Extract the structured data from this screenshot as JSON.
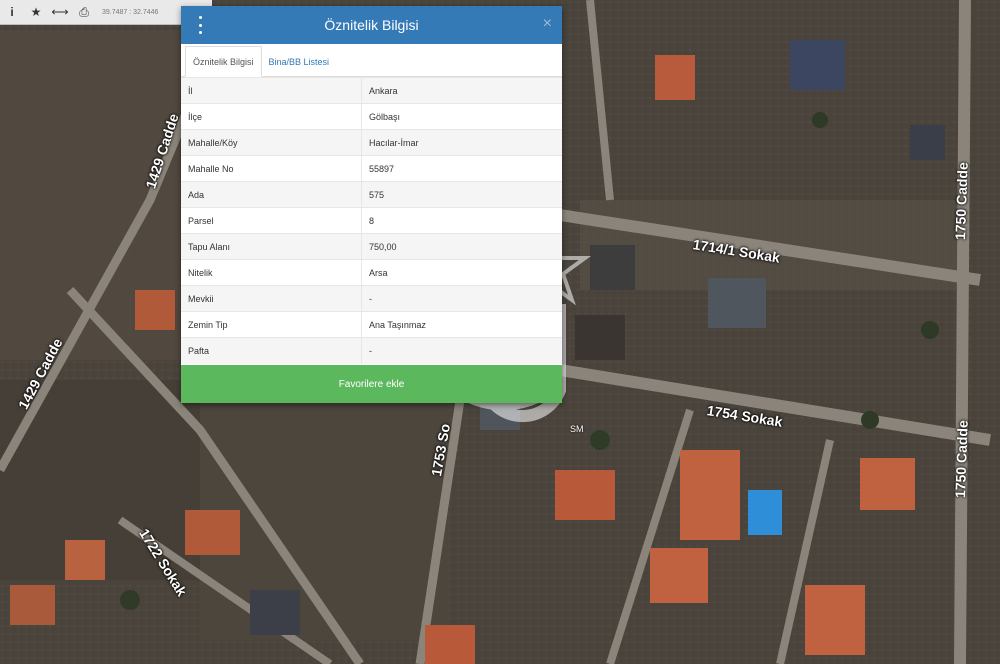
{
  "toolbar": {
    "icons": [
      "info-icon",
      "star-icon",
      "measure-icon",
      "print-icon"
    ],
    "info_glyph": "i",
    "star_glyph": "★",
    "measure_glyph": "⟷",
    "print_glyph": "⎙",
    "coords": "39.7487 : 32.7446"
  },
  "dialog": {
    "title": "Öznitelik Bilgisi",
    "close_glyph": "×",
    "tabs": [
      {
        "label": "Öznitelik Bilgisi",
        "active": true
      },
      {
        "label": "Bina/BB Listesi",
        "active": false
      }
    ],
    "rows": [
      {
        "key": "İl",
        "value": "Ankara"
      },
      {
        "key": "İlçe",
        "value": "Gölbaşı"
      },
      {
        "key": "Mahalle/Köy",
        "value": "Hacılar-İmar"
      },
      {
        "key": "Mahalle No",
        "value": "55897"
      },
      {
        "key": "Ada",
        "value": "575"
      },
      {
        "key": "Parsel",
        "value": "8"
      },
      {
        "key": "Tapu Alanı",
        "value": "750,00"
      },
      {
        "key": "Nitelik",
        "value": "Arsa"
      },
      {
        "key": "Mevkii",
        "value": "-"
      },
      {
        "key": "Zemin Tip",
        "value": "Ana Taşınmaz"
      },
      {
        "key": "Pafta",
        "value": "-"
      }
    ],
    "favorite_button": "Favorilere ekle"
  },
  "map": {
    "streets": [
      {
        "id": "1429-cadde-top",
        "label": "1429 Cadde"
      },
      {
        "id": "1429-cadde-left",
        "label": "1429 Cadde"
      },
      {
        "id": "1714-1-sokak",
        "label": "1714/1 Sokak"
      },
      {
        "id": "1754-sokak",
        "label": "1754 Sokak"
      },
      {
        "id": "1750-cadde-top",
        "label": "1750 Cadde"
      },
      {
        "id": "1750-cadde-bottom",
        "label": "1750 Cadde"
      },
      {
        "id": "1753-sokak",
        "label": "1753 So"
      },
      {
        "id": "1722-sokak",
        "label": "1722 Sokak"
      }
    ],
    "watermark_letters": "SM",
    "colors": {
      "header": "#337ab7",
      "favorite": "#5cb85c",
      "tab_link": "#337ab7"
    }
  }
}
